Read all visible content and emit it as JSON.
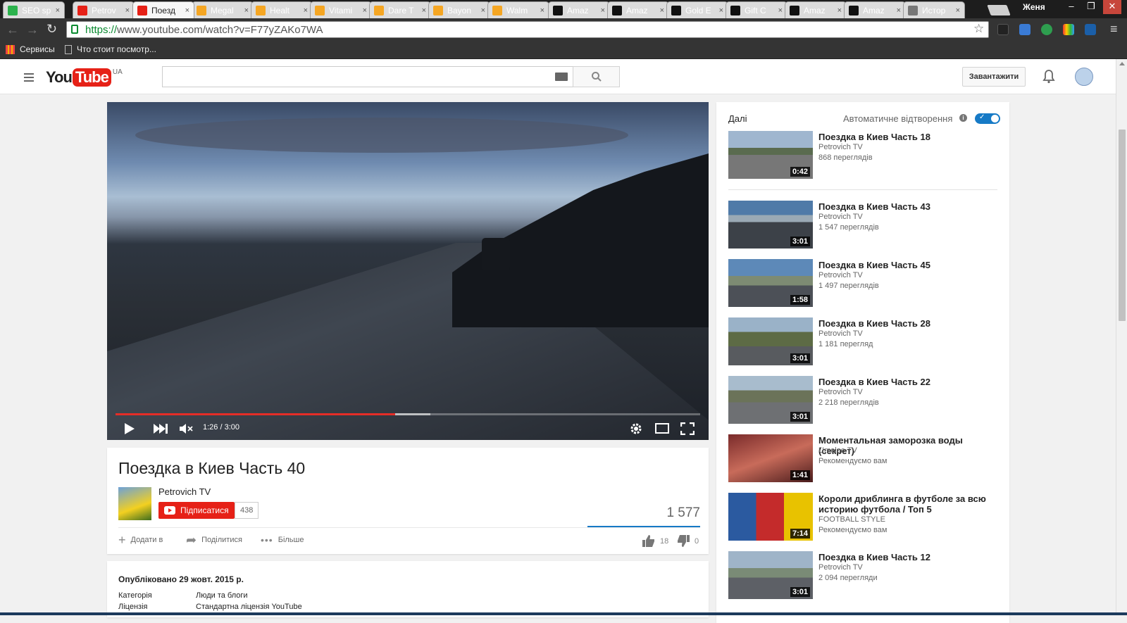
{
  "browser": {
    "tabs": [
      {
        "title": "SEO sp",
        "color": "#2bb24c",
        "icon": "seo-icon"
      },
      {
        "title": "Petrov",
        "color": "#e62117",
        "icon": "youtube-icon"
      },
      {
        "title": "Поезд",
        "color": "#e62117",
        "icon": "youtube-icon",
        "active": true
      },
      {
        "title": "Megal",
        "color": "#f5a623",
        "icon": "walmart-icon"
      },
      {
        "title": "Healt",
        "color": "#f5a623",
        "icon": "walmart-icon"
      },
      {
        "title": "Vitami",
        "color": "#f5a623",
        "icon": "walmart-icon"
      },
      {
        "title": "Dare T",
        "color": "#f5a623",
        "icon": "walmart-icon"
      },
      {
        "title": "Bayon",
        "color": "#f5a623",
        "icon": "walmart-icon"
      },
      {
        "title": "Walm",
        "color": "#f5a623",
        "icon": "walmart-icon"
      },
      {
        "title": "Amaz",
        "color": "#111111",
        "icon": "amazon-icon"
      },
      {
        "title": "Amaz",
        "color": "#111111",
        "icon": "amazon-icon"
      },
      {
        "title": "Gold E",
        "color": "#111111",
        "icon": "amazon-icon"
      },
      {
        "title": "Gift C",
        "color": "#111111",
        "icon": "amazon-icon"
      },
      {
        "title": "Amaz",
        "color": "#111111",
        "icon": "amazon-icon"
      },
      {
        "title": "Amaz",
        "color": "#111111",
        "icon": "amazon-icon"
      },
      {
        "title": "Истор",
        "color": "#777777",
        "icon": "history-icon"
      }
    ],
    "user": "Женя",
    "url_https": "https://",
    "url_rest": "www.youtube.com/watch?v=F77yZAKo7WA",
    "bookmarks": {
      "apps": "Сервисы",
      "folder": "Что стоит посмотр..."
    }
  },
  "youtube": {
    "region": "UA",
    "upload_label": "Завантажити",
    "search_placeholder": ""
  },
  "player": {
    "current_time": "1:26 / 3:00",
    "progress_fraction": 0.478,
    "buffered_fraction": 0.538
  },
  "video": {
    "title": "Поездка в Киев Часть 40",
    "channel": "Petrovich TV",
    "subscribe_label": "Підписатися",
    "subscriber_count": "438",
    "views": "1 577",
    "actions": {
      "add": "Додати в",
      "share": "Поділитися",
      "more": "Більше"
    },
    "likes": "18",
    "dislikes": "0",
    "published": "Опубліковано 29 жовт. 2015 р.",
    "meta": [
      {
        "key": "Категорія",
        "value": "Люди та блоги"
      },
      {
        "key": "Ліцензія",
        "value": "Стандартна ліцензія YouTube"
      }
    ]
  },
  "sidebar": {
    "next_label": "Далі",
    "autoplay_label": "Автоматичне відтворення",
    "autoplay_on": true,
    "items": [
      {
        "title": "Поездка в Киев Часть 18",
        "channel": "Petrovich TV",
        "views": "868 переглядів",
        "duration": "0:42"
      },
      {
        "title": "Поездка в Киев Часть 43",
        "channel": "Petrovich TV",
        "views": "1 547 переглядів",
        "duration": "3:01"
      },
      {
        "title": "Поездка в Киев Часть 45",
        "channel": "Petrovich TV",
        "views": "1 497 переглядів",
        "duration": "1:58"
      },
      {
        "title": "Поездка в Киев Часть 28",
        "channel": "Petrovich TV",
        "views": "1 181 перегляд",
        "duration": "3:01"
      },
      {
        "title": "Поездка в Киев Часть 22",
        "channel": "Petrovich TV",
        "views": "2 218 переглядів",
        "duration": "3:01"
      },
      {
        "title": "Моментальная заморозка воды (секрет)",
        "channel": "Umeloe TV",
        "views": "Рекомендуємо вам",
        "duration": "1:41"
      },
      {
        "title": "Короли дриблинга в футболе за всю историю футбола / Топ 5",
        "channel": "FOOTBALL STYLE",
        "views": "Рекомендуємо вам",
        "duration": "7:14"
      },
      {
        "title": "Поездка в Киев Часть 12",
        "channel": "Petrovich TV",
        "views": "2 094 перегляди",
        "duration": "3:01"
      }
    ]
  }
}
